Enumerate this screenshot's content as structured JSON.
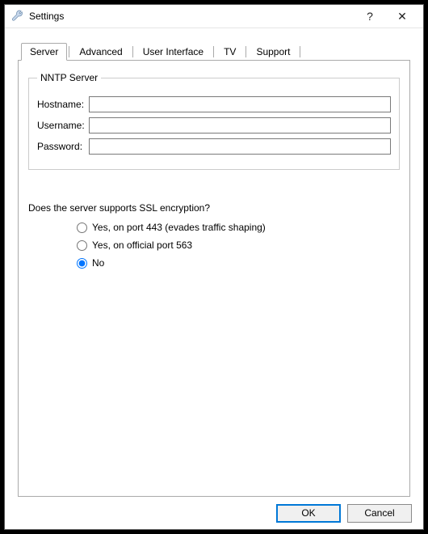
{
  "window": {
    "title": "Settings",
    "help_symbol": "?",
    "close_symbol": "✕"
  },
  "tabs": {
    "items": [
      {
        "label": "Server",
        "active": true
      },
      {
        "label": "Advanced",
        "active": false
      },
      {
        "label": "User Interface",
        "active": false
      },
      {
        "label": "TV",
        "active": false
      },
      {
        "label": "Support",
        "active": false
      }
    ]
  },
  "group": {
    "legend": "NNTP Server",
    "fields": {
      "hostname": {
        "label": "Hostname:",
        "value": ""
      },
      "username": {
        "label": "Username:",
        "value": ""
      },
      "password": {
        "label": "Password:",
        "value": ""
      }
    }
  },
  "ssl": {
    "question": "Does the server supports SSL encryption?",
    "options": [
      {
        "label": "Yes, on port 443 (evades traffic shaping)",
        "selected": false
      },
      {
        "label": "Yes, on official port 563",
        "selected": false
      },
      {
        "label": "No",
        "selected": true
      }
    ]
  },
  "buttons": {
    "ok": "OK",
    "cancel": "Cancel"
  }
}
